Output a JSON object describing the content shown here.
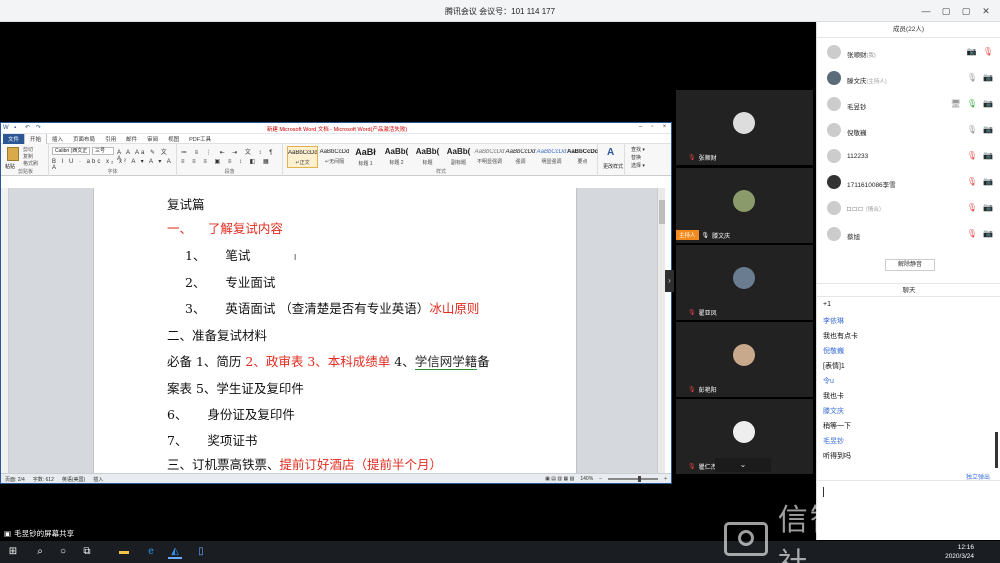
{
  "app": {
    "title": "腾讯会议 会议号：101 114 177"
  },
  "window_controls": [
    "—",
    "▢",
    "▢",
    "✕"
  ],
  "word": {
    "title": "新建 Microsoft Word 文档 - Microsoft Word(产品激活失败)",
    "tabs": [
      "文件",
      "开始",
      "插入",
      "页面布局",
      "引用",
      "邮件",
      "审阅",
      "视图",
      "PDF工具"
    ],
    "paste_label": "粘贴",
    "clip_items": [
      "剪切",
      "复制",
      "格式刷"
    ],
    "font_name": "Calibri (西文正",
    "font_size": "三号",
    "group_labels": {
      "clipboard": "剪贴板",
      "font": "字体",
      "paragraph": "段落",
      "styles": "样式"
    },
    "styles": [
      {
        "sample": "AaBbCcDd",
        "name": "↵正文",
        "selected": true
      },
      {
        "sample": "AaBbCcDd",
        "name": "↵无间隔"
      },
      {
        "sample": "AaBł",
        "name": "标题 1"
      },
      {
        "sample": "AaBb(",
        "name": "标题 2"
      },
      {
        "sample": "AaBb(",
        "name": "标题"
      },
      {
        "sample": "AaBb(",
        "name": "副标题"
      },
      {
        "sample": "AaBbCcDd",
        "name": "不明显强调"
      },
      {
        "sample": "AaBbCcDd",
        "name": "强调"
      },
      {
        "sample": "AaBbCcDd",
        "name": "明显强调"
      },
      {
        "sample": "AaBbCcDc",
        "name": "要点"
      }
    ],
    "change_styles": "更改样式",
    "edit_items": [
      "查找 ▾",
      "替换",
      "选择 ▾"
    ],
    "doc": {
      "heading": "复试篇",
      "line1_num": "一、",
      "line1": "了解复试内容",
      "item1_num": "1、",
      "item1": "笔试",
      "item2_num": "2、",
      "item2": "专业面试",
      "item3_num": "3、",
      "item3_a": "英语面试 （查清楚是否有专业英语）",
      "item3_b": "冰山原则",
      "line2": "二、准备复试材料",
      "line3_a": "必备 1、简历 ",
      "line3_b": "2、政审表 3、本科成绩单",
      "line3_c": " 4、",
      "line3_d": "学信网学籍",
      "line3_e": "备",
      "line4": "案表 5、学生证及复印件 ",
      "line5_num": "6、",
      "line5": "身份证及复印件",
      "line6_num": "7、",
      "line6": "奖项证书",
      "line7_a": "三、订机票高铁票、",
      "line7_b": "提前订好酒店（提前半个月）"
    },
    "status": {
      "page": "页面: 2/4",
      "words": "字数: 612",
      "lang": "英语(美国)",
      "mode": "插入",
      "zoom": "140%"
    }
  },
  "videos": [
    {
      "name": "张顺财"
    },
    {
      "name": "滕文庆",
      "badge": "主持人"
    },
    {
      "name": "翟亚凤"
    },
    {
      "name": "彭艳阳"
    },
    {
      "name": "瞿仁杰"
    }
  ],
  "members_panel": {
    "title": "成员(22人)",
    "members": [
      {
        "name": "张顺财",
        "note": "(我)"
      },
      {
        "name": "滕文庆",
        "note": "(主持人)"
      },
      {
        "name": "毛昱钞",
        "note": ""
      },
      {
        "name": "倪敬巍",
        "note": ""
      },
      {
        "name": "112233",
        "note": ""
      },
      {
        "name": "1711610086李雪",
        "note": ""
      },
      {
        "name": "□ □ □",
        "note": "（情合）"
      },
      {
        "name": "蔡旭",
        "note": ""
      }
    ],
    "mute_all": "解除静音"
  },
  "chat": {
    "title": "聊天",
    "messages": [
      "+1",
      "李依琳",
      "我也有点卡",
      "倪敬巍",
      "[表情]1",
      "令u",
      "我也卡",
      "滕文庆",
      "稍等一下",
      "毛昱钞",
      "听得到吗"
    ],
    "popout": "独立弹出"
  },
  "share_caption": "毛昱钞的屏幕共享",
  "taskbar": {
    "clock_time": "12:16",
    "clock_date": "2020/3/24"
  },
  "watermark": "信智学院通讯社"
}
